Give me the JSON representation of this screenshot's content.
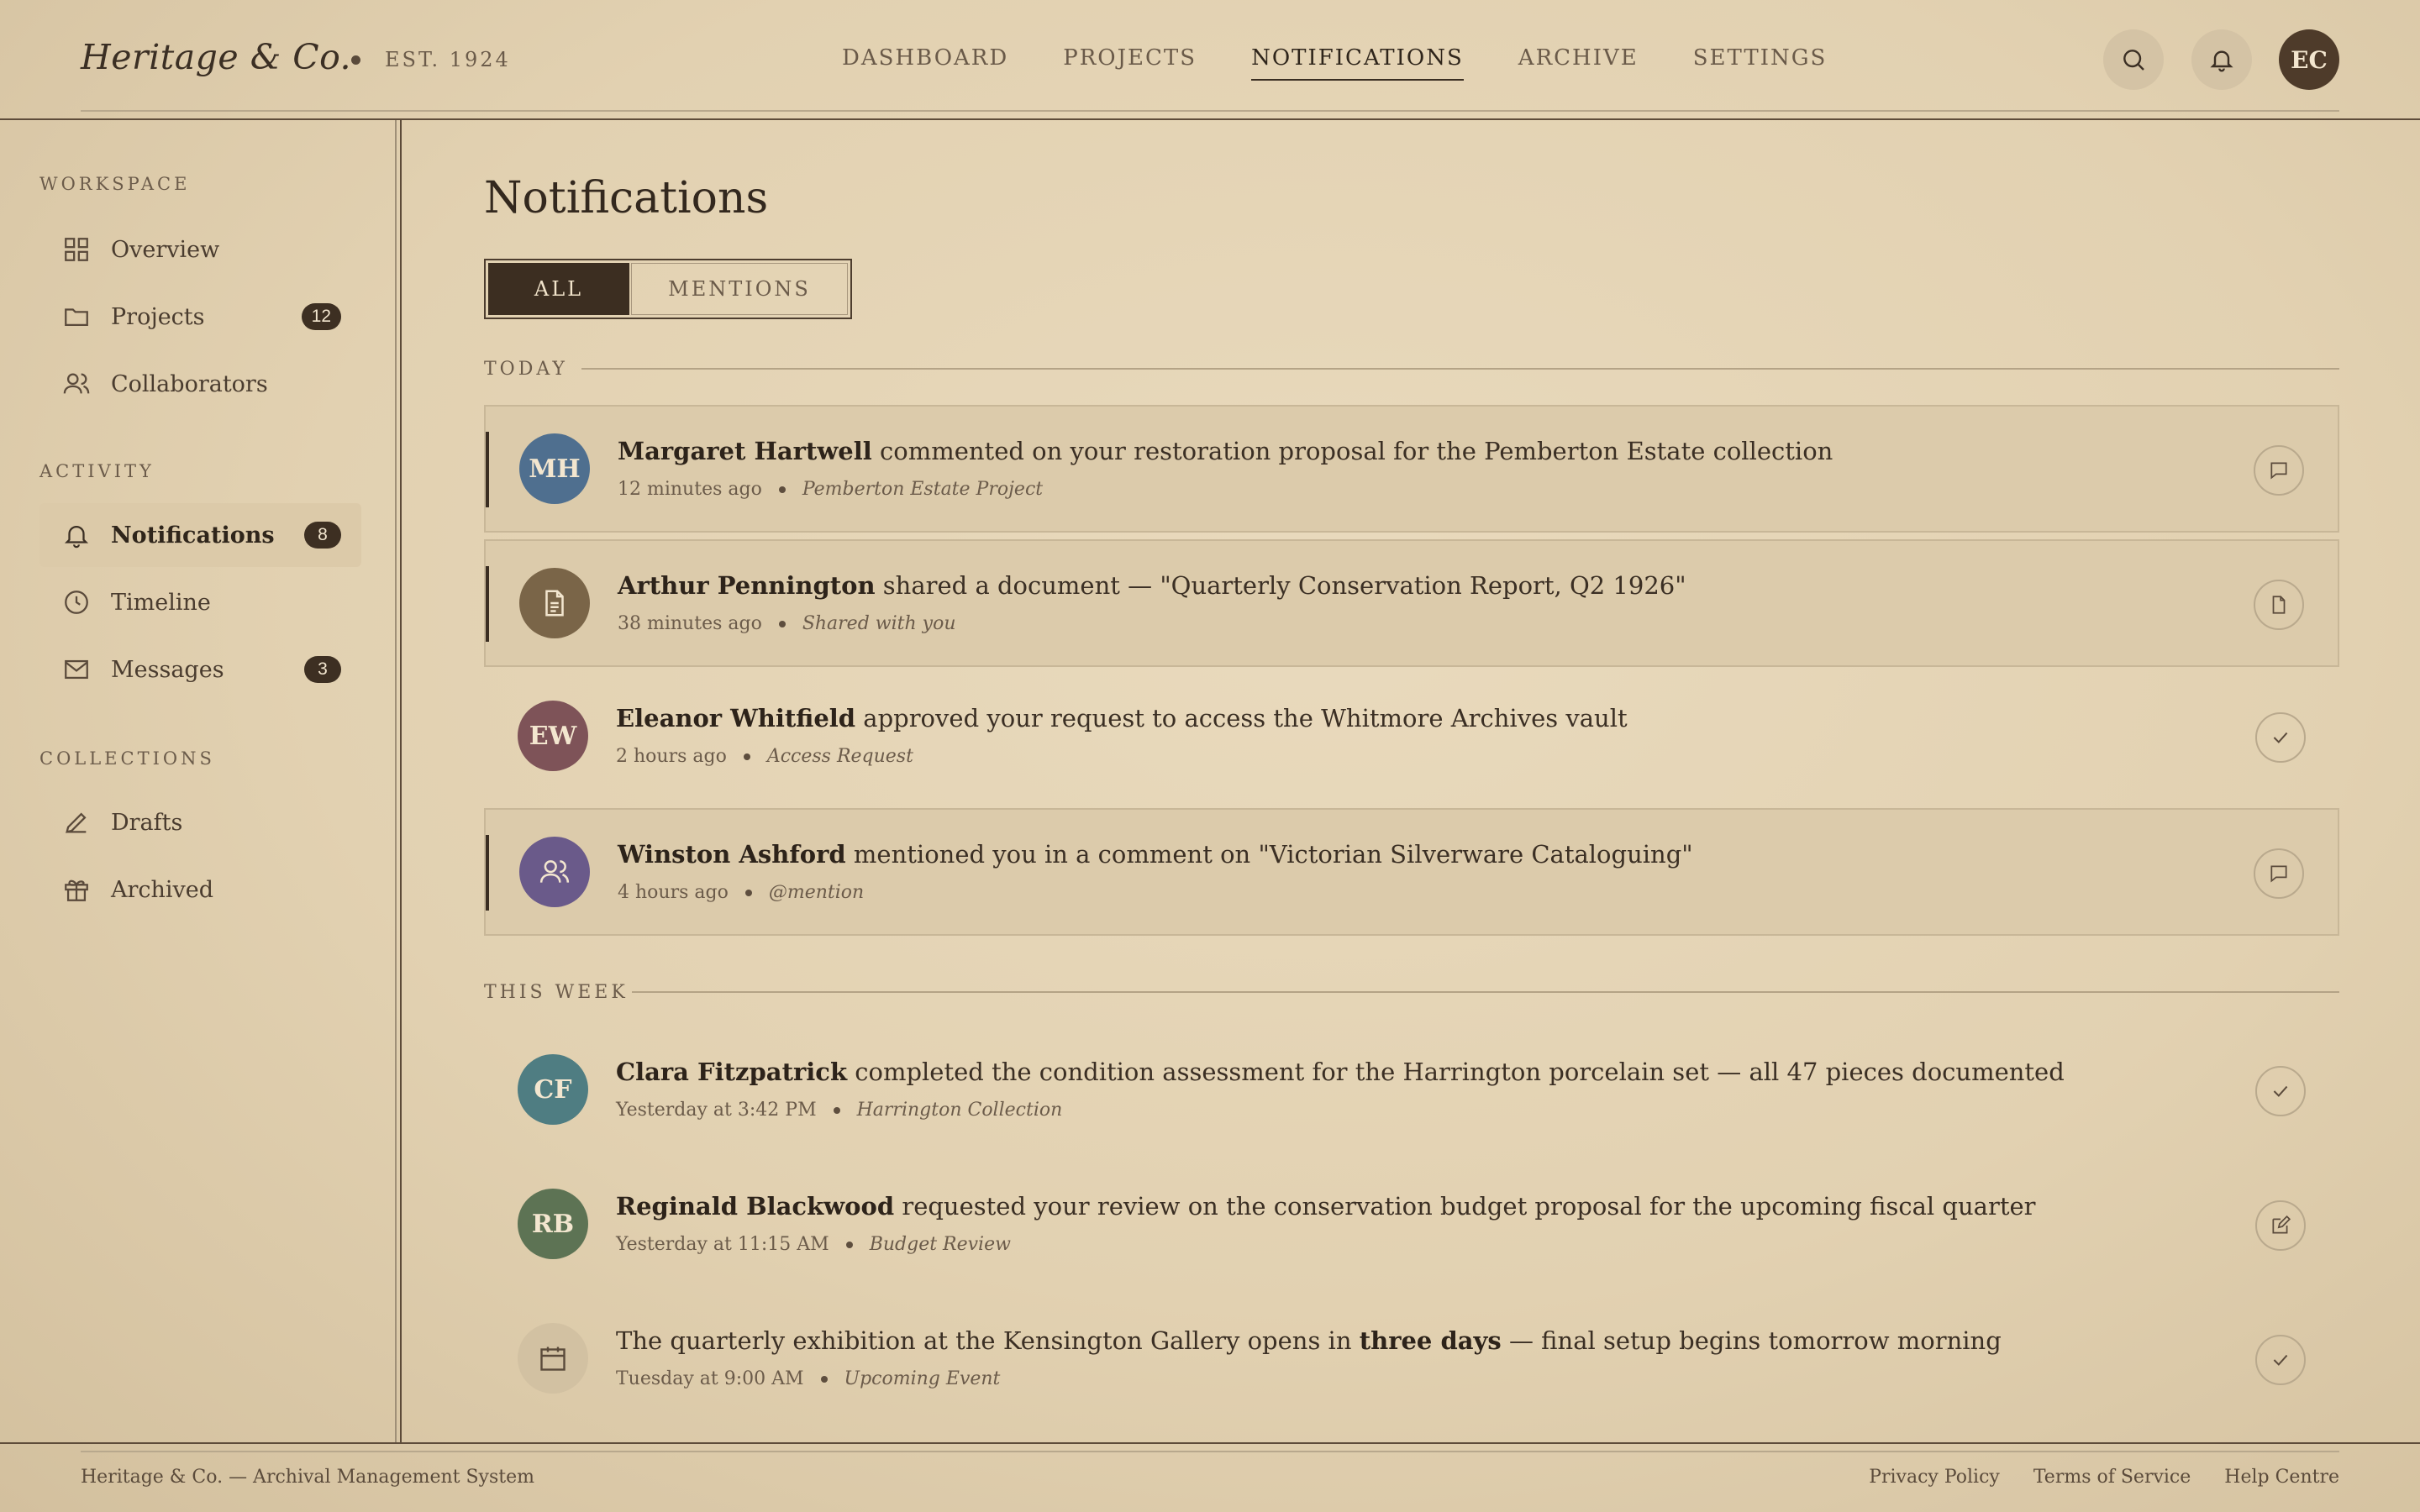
{
  "header": {
    "brand": "Heritage & Co.",
    "established": "EST. 1924",
    "nav": [
      "DASHBOARD",
      "PROJECTS",
      "NOTIFICATIONS",
      "ARCHIVE",
      "SETTINGS"
    ],
    "active_nav": "NOTIFICATIONS",
    "user_initials": "EC"
  },
  "sidebar": {
    "sections": [
      {
        "label": "WORKSPACE",
        "items": [
          {
            "label": "Overview",
            "icon": "grid-icon"
          },
          {
            "label": "Projects",
            "icon": "folder-icon",
            "badge": "12"
          },
          {
            "label": "Collaborators",
            "icon": "users-icon"
          }
        ]
      },
      {
        "label": "ACTIVITY",
        "items": [
          {
            "label": "Notifications",
            "icon": "bell-icon",
            "badge": "8",
            "active": true
          },
          {
            "label": "Timeline",
            "icon": "clock-icon"
          },
          {
            "label": "Messages",
            "icon": "mail-icon",
            "badge": "3"
          }
        ]
      },
      {
        "label": "COLLECTIONS",
        "items": [
          {
            "label": "Drafts",
            "icon": "pen-icon"
          },
          {
            "label": "Archived",
            "icon": "gift-icon"
          }
        ]
      }
    ]
  },
  "main": {
    "title": "Notifications",
    "tabs": [
      "ALL",
      "MENTIONS"
    ],
    "active_tab": "ALL",
    "groups": [
      {
        "label": "TODAY",
        "items": [
          {
            "avatar": "MH",
            "avatar_color": "#4f6f8f",
            "actor": "Margaret Hartwell",
            "text": " commented on your restoration proposal for the Pemberton Estate collection",
            "time": "12 minutes ago",
            "context": "Pemberton Estate Project",
            "action_icon": "comment-icon",
            "unread": true
          },
          {
            "avatar_icon": "document-icon",
            "avatar_color": "#7a6548",
            "actor": "Arthur Pennington",
            "text": " shared a document — \"Quarterly Conservation Report, Q2 1926\"",
            "time": "38 minutes ago",
            "context": "Shared with you",
            "action_icon": "file-icon",
            "unread": true
          },
          {
            "avatar": "EW",
            "avatar_color": "#7e5358",
            "actor": "Eleanor Whitfield",
            "text": " approved your request to access the Whitmore Archives vault",
            "time": "2 hours ago",
            "context": "Access Request",
            "action_icon": "check-icon",
            "unread": false
          },
          {
            "avatar_icon": "users-icon",
            "avatar_color": "#6a5a8a",
            "actor": "Winston Ashford",
            "text": " mentioned you in a comment on \"Victorian Silverware Cataloguing\"",
            "time": "4 hours ago",
            "context": "@mention",
            "action_icon": "comment-icon",
            "unread": true
          }
        ]
      },
      {
        "label": "THIS WEEK",
        "items": [
          {
            "avatar": "CF",
            "avatar_color": "#4f7d82",
            "actor": "Clara Fitzpatrick",
            "text": " completed the condition assessment for the Harrington porcelain set — all 47 pieces documented",
            "time": "Yesterday at 3:42 PM",
            "context": "Harrington Collection",
            "action_icon": "check-icon",
            "unread": false
          },
          {
            "avatar": "RB",
            "avatar_color": "#5d7354",
            "actor": "Reginald Blackwood",
            "text": " requested your review on the conservation budget proposal for the upcoming fiscal quarter",
            "time": "Yesterday at 11:15 AM",
            "context": "Budget Review",
            "action_icon": "edit-icon",
            "unread": false
          },
          {
            "avatar_icon": "calendar-icon",
            "avatar_color": "#d2c1a2",
            "text_pre": "The quarterly exhibition at the Kensington Gallery opens in ",
            "emphasis": "three days",
            "text": " — final setup begins tomorrow morning",
            "time": "Tuesday at 9:00 AM",
            "context": "Upcoming Event",
            "action_icon": "check-icon",
            "unread": false
          }
        ]
      }
    ]
  },
  "footer": {
    "left": "Heritage & Co. — Archival Management System",
    "links": [
      "Privacy Policy",
      "Terms of Service",
      "Help Centre"
    ]
  }
}
